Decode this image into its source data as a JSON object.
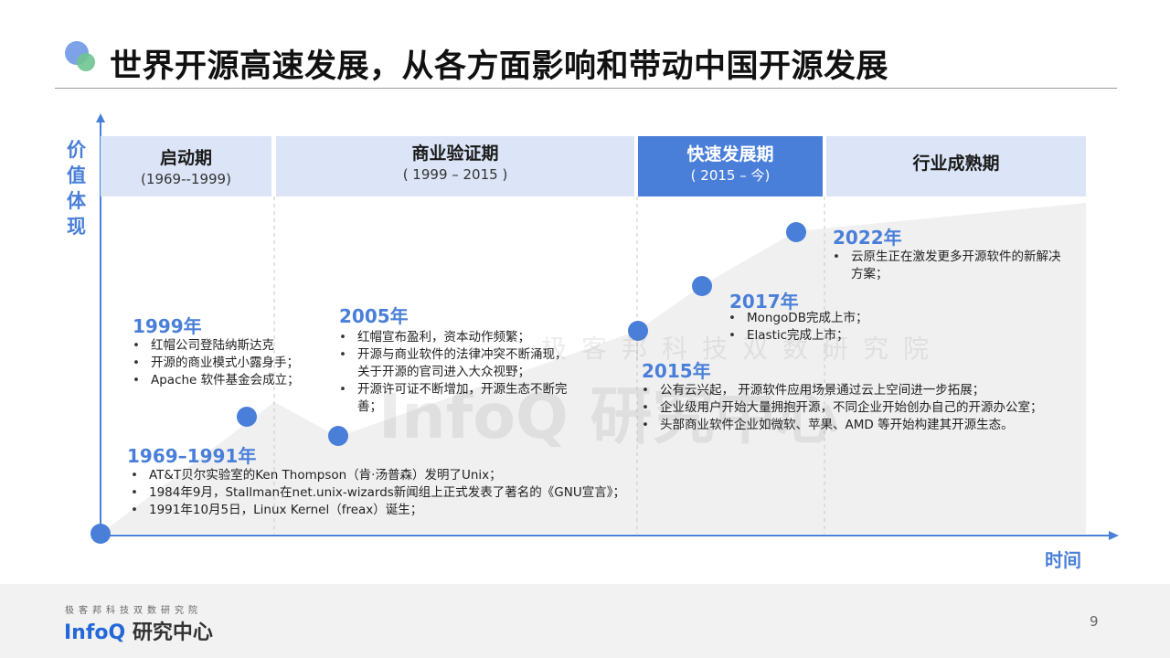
{
  "title": "世界开源高速发展，从各方面影响和带动中国开源发展",
  "y_axis_label": [
    "价",
    "值",
    "体",
    "现"
  ],
  "x_axis_label": "时间",
  "watermark": {
    "line1": "极客邦科技双数研究院",
    "line2": "InfoQ 研究中心"
  },
  "phases": [
    {
      "title": "启动期",
      "range": "(1969--1999)",
      "active": false
    },
    {
      "title": "商业验证期",
      "range": "( 1999 – 2015 )",
      "active": false
    },
    {
      "title": "快速发展期",
      "range": "( 2015 – 今)",
      "active": true
    },
    {
      "title": "行业成熟期",
      "range": "",
      "active": false
    }
  ],
  "milestones": [
    {
      "year": "1969–1991年",
      "points": [
        "AT&T贝尔实验室的Ken Thompson（肯·汤普森）发明了Unix；",
        "1984年9月，Stallman在net.unix-wizards新闻组上正式发表了著名的《GNU宣言》；",
        "1991年10月5日，Linux Kernel（freax）诞生；"
      ]
    },
    {
      "year": "1999年",
      "points": [
        "红帽公司登陆纳斯达克",
        "开源的商业模式小露身手；",
        "Apache 软件基金会成立；"
      ]
    },
    {
      "year": "2005年",
      "points": [
        "红帽宣布盈利，资本动作频繁；",
        "开源与商业软件的法律冲突不断涌现，关于开源的官司进入大众视野；",
        "开源许可证不断增加，开源生态不断完善；"
      ]
    },
    {
      "year": "2015年",
      "points": [
        "公有云兴起， 开源软件应用场景通过云上空间进一步拓展；",
        "企业级用户开始大量拥抱开源，不同企业开始创办自己的开源办公室；",
        "头部商业软件企业如微软、苹果、AMD 等开始构建其开源生态。"
      ]
    },
    {
      "year": "2017年",
      "points": [
        "MongoDB完成上市；",
        "Elastic完成上市；"
      ]
    },
    {
      "year": "2022年",
      "points": [
        "云原生正在激发更多开源软件的新解决方案；"
      ]
    }
  ],
  "footer": {
    "subtitle": "极客邦科技双数研究院",
    "brand_en": "InfoQ",
    "brand_cn": "研究中心"
  },
  "page_number": "9",
  "colors": {
    "accent": "#4a7fd9",
    "band": "#dbe5f7",
    "area": "#f0f0f0",
    "axis": "#4a7fd9"
  }
}
